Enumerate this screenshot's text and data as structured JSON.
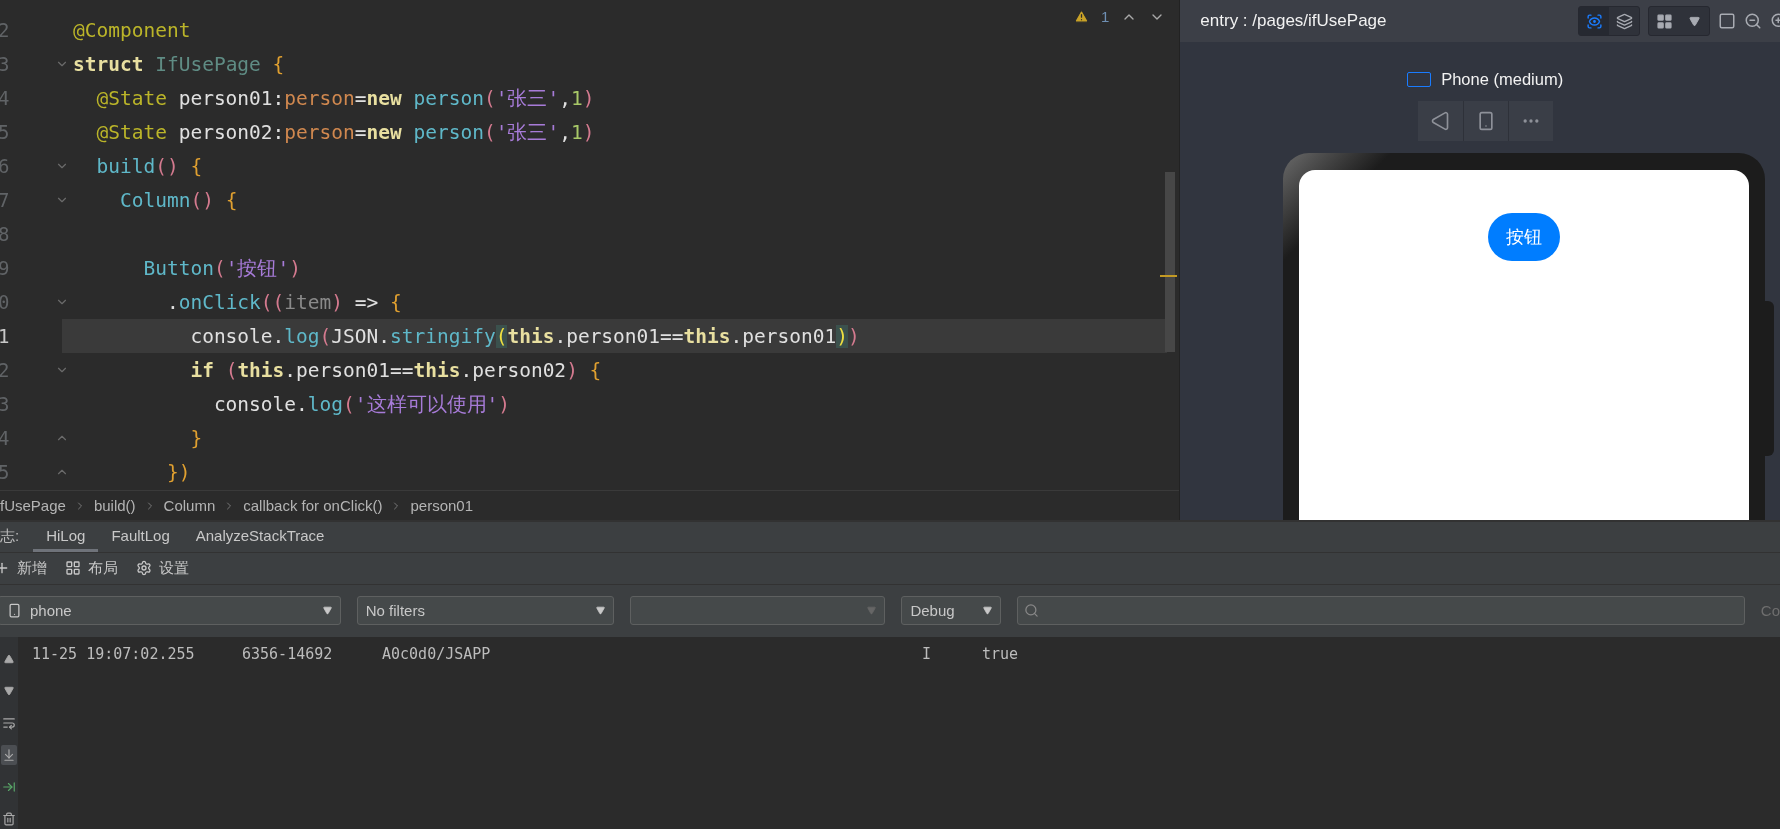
{
  "editor": {
    "problems": "1",
    "lines": [
      {
        "number": "2",
        "current": false,
        "tokens": [
          {
            "kind": "decorator",
            "text": "@Component"
          }
        ]
      },
      {
        "number": "3",
        "current": false,
        "fold_start": true,
        "tokens": [
          {
            "kind": "keyword",
            "text": "struct "
          },
          {
            "kind": "class",
            "text": "IfUsePage "
          },
          {
            "kind": "brace",
            "text": "{"
          }
        ]
      },
      {
        "number": "4",
        "current": false,
        "tokens": [
          {
            "kind": "decorator",
            "text": "  @State"
          },
          {
            "kind": "plain",
            "text": " person01:"
          },
          {
            "kind": "type",
            "text": "person"
          },
          {
            "kind": "plain",
            "text": "="
          },
          {
            "kind": "keyword",
            "text": "new "
          },
          {
            "kind": "func",
            "text": "person"
          },
          {
            "kind": "paren",
            "text": "("
          },
          {
            "kind": "string",
            "text": "'张三'"
          },
          {
            "kind": "plain",
            "text": ","
          },
          {
            "kind": "number",
            "text": "1"
          },
          {
            "kind": "paren",
            "text": ")"
          }
        ]
      },
      {
        "number": "5",
        "current": false,
        "tokens": [
          {
            "kind": "decorator",
            "text": "  @State"
          },
          {
            "kind": "plain",
            "text": " person02:"
          },
          {
            "kind": "type",
            "text": "person"
          },
          {
            "kind": "plain",
            "text": "="
          },
          {
            "kind": "keyword",
            "text": "new "
          },
          {
            "kind": "func",
            "text": "person"
          },
          {
            "kind": "paren",
            "text": "("
          },
          {
            "kind": "string",
            "text": "'张三'"
          },
          {
            "kind": "plain",
            "text": ","
          },
          {
            "kind": "number",
            "text": "1"
          },
          {
            "kind": "paren",
            "text": ")"
          }
        ]
      },
      {
        "number": "6",
        "current": false,
        "fold_start": true,
        "tokens": [
          {
            "kind": "func",
            "text": "  build"
          },
          {
            "kind": "paren",
            "text": "() "
          },
          {
            "kind": "brace",
            "text": "{"
          }
        ]
      },
      {
        "number": "7",
        "current": false,
        "fold_start": true,
        "tokens": [
          {
            "kind": "func",
            "text": "    Column"
          },
          {
            "kind": "paren",
            "text": "() "
          },
          {
            "kind": "brace",
            "text": "{"
          }
        ]
      },
      {
        "number": "8",
        "current": false
      },
      {
        "number": "9",
        "current": false,
        "tokens": [
          {
            "kind": "func",
            "text": "      Button"
          },
          {
            "kind": "paren",
            "text": "("
          },
          {
            "kind": "string",
            "text": "'按钮'"
          },
          {
            "kind": "paren",
            "text": ")"
          }
        ]
      },
      {
        "number": "0",
        "current": false,
        "fold_start": true,
        "tokens": [
          {
            "kind": "plain",
            "text": "        ."
          },
          {
            "kind": "func",
            "text": "onClick"
          },
          {
            "kind": "paren",
            "text": "(("
          },
          {
            "kind": "param",
            "text": "item"
          },
          {
            "kind": "paren",
            "text": ")"
          },
          {
            "kind": "plain",
            "text": " => "
          },
          {
            "kind": "brace",
            "text": "{"
          }
        ]
      },
      {
        "number": "1",
        "current": true,
        "tokens": [
          {
            "kind": "plain",
            "text": "          console."
          },
          {
            "kind": "func",
            "text": "log"
          },
          {
            "kind": "paren",
            "text": "("
          },
          {
            "kind": "plain",
            "text": "JSON."
          },
          {
            "kind": "func",
            "text": "stringify"
          },
          {
            "kind": "match",
            "text": "("
          },
          {
            "kind": "keyword",
            "text": "this"
          },
          {
            "kind": "plain",
            "text": ".person01=="
          },
          {
            "kind": "keyword",
            "text": "this"
          },
          {
            "kind": "plain",
            "text": ".person01"
          },
          {
            "kind": "match",
            "text": ")"
          },
          {
            "kind": "paren",
            "text": ")"
          }
        ]
      },
      {
        "number": "2",
        "current": false,
        "fold_start": true,
        "tokens": [
          {
            "kind": "keyword",
            "text": "          if"
          },
          {
            "kind": "paren",
            "text": " ("
          },
          {
            "kind": "keyword",
            "text": "this"
          },
          {
            "kind": "plain",
            "text": ".person01=="
          },
          {
            "kind": "keyword",
            "text": "this"
          },
          {
            "kind": "plain",
            "text": ".person02"
          },
          {
            "kind": "paren",
            "text": ") "
          },
          {
            "kind": "brace",
            "text": "{"
          }
        ]
      },
      {
        "number": "3",
        "current": false,
        "tokens": [
          {
            "kind": "plain",
            "text": "            console."
          },
          {
            "kind": "func",
            "text": "log"
          },
          {
            "kind": "paren",
            "text": "("
          },
          {
            "kind": "string",
            "text": "'这样可以使用'"
          },
          {
            "kind": "paren",
            "text": ")"
          }
        ]
      },
      {
        "number": "4",
        "current": false,
        "fold_end": true,
        "tokens": [
          {
            "kind": "brace",
            "text": "          }"
          }
        ]
      },
      {
        "number": "5",
        "current": false,
        "fold_end": true,
        "tokens": [
          {
            "kind": "brace",
            "text": "        })"
          }
        ]
      }
    ]
  },
  "breadcrumb": [
    "fUsePage",
    "build()",
    "Column",
    "callback for onClick()",
    "person01"
  ],
  "preview": {
    "path": "entry : /pages/ifUsePage",
    "view_tools": [
      {
        "kind": "inspect",
        "selected": true
      },
      {
        "kind": "layers",
        "selected": false
      }
    ],
    "device": "Phone (medium)",
    "screen_button": "按钮"
  },
  "log_panel": {
    "label": "志:",
    "tabs": [
      {
        "label": "HiLog",
        "selected": true
      },
      {
        "label": "FaultLog",
        "selected": false
      },
      {
        "label": "AnalyzeStackTrace",
        "selected": false
      }
    ],
    "actions": [
      {
        "kind": "add",
        "label": "新增"
      },
      {
        "kind": "layout",
        "label": "布局"
      },
      {
        "kind": "settings",
        "label": "设置"
      }
    ],
    "filters": {
      "device": "phone",
      "filter": "No filters",
      "level": "Debug",
      "cut_label": "Co"
    },
    "side_tools": [
      {
        "kind": "up",
        "selected": false
      },
      {
        "kind": "down",
        "selected": false
      },
      {
        "kind": "wrap",
        "selected": false
      },
      {
        "kind": "scroll_end",
        "selected": true
      },
      {
        "kind": "restart",
        "selected": false
      },
      {
        "kind": "clear",
        "selected": false
      }
    ],
    "rows": [
      {
        "time": "11-25 19:07:02.255",
        "pid": "6356-14692",
        "tag": "A0c0d0/JSAPP",
        "level": "I",
        "message": "true"
      }
    ]
  }
}
